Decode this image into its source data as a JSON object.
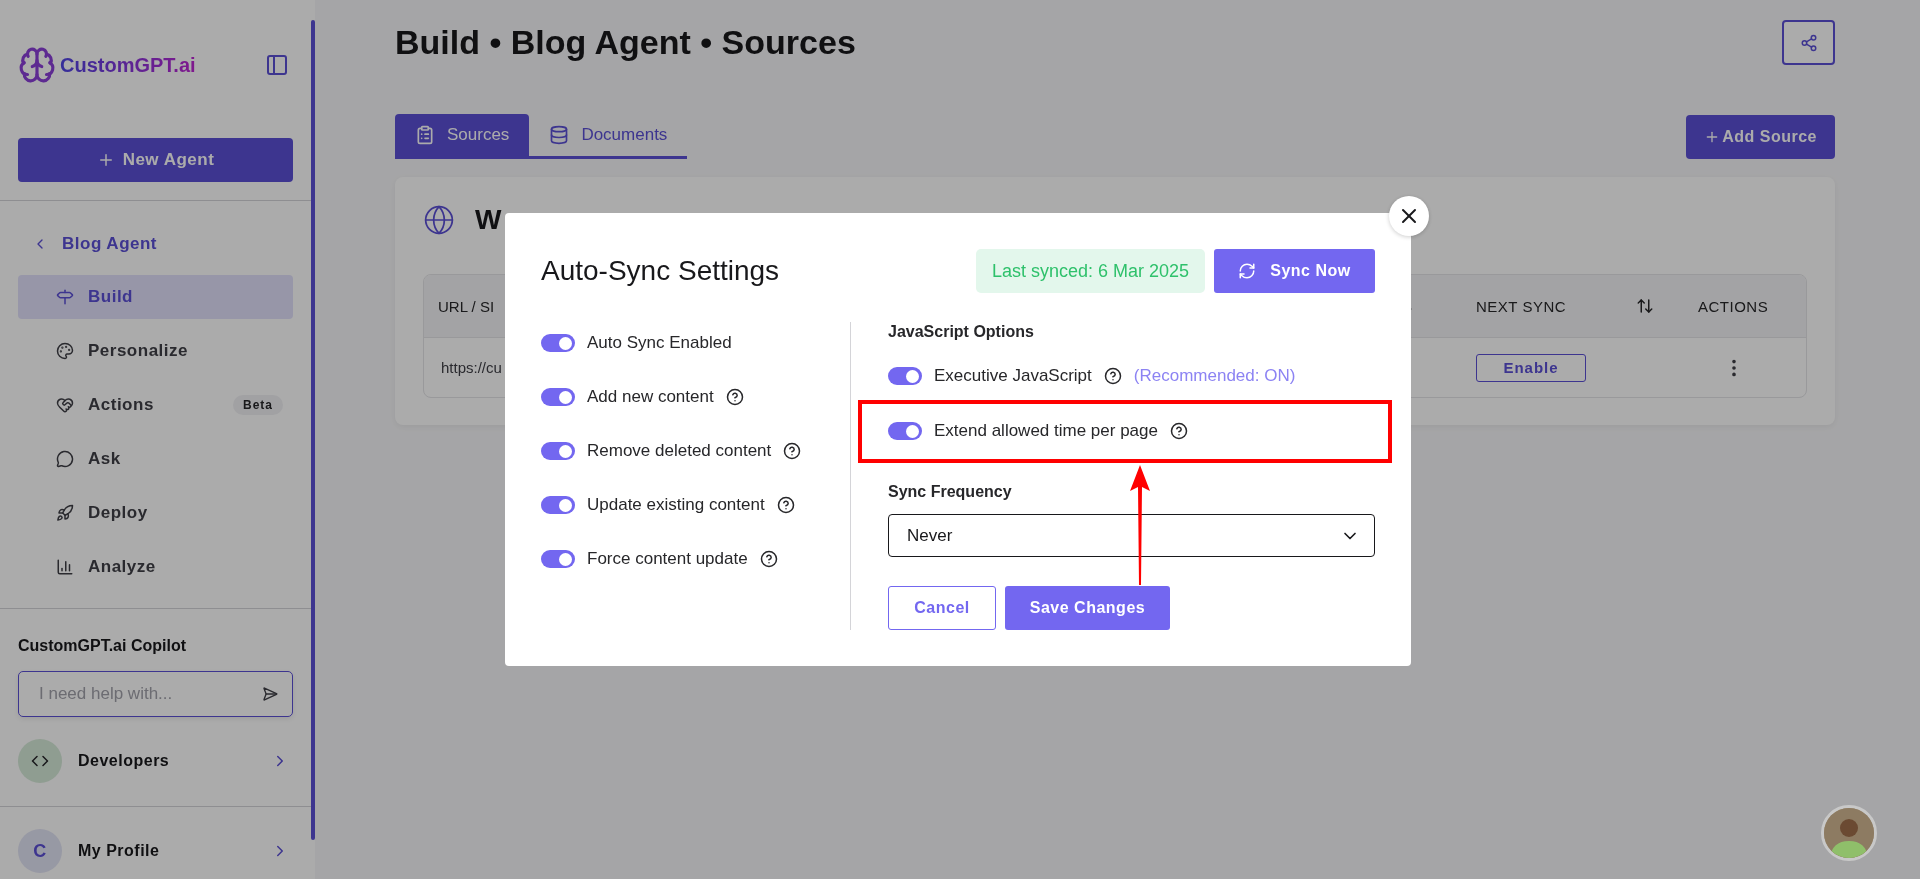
{
  "sidebar": {
    "logo": "CustomGPT.ai",
    "new_agent": "New Agent",
    "back": "Blog Agent",
    "items": [
      {
        "label": "Build",
        "selected": true
      },
      {
        "label": "Personalize",
        "selected": false
      },
      {
        "label": "Actions",
        "selected": false,
        "badge": "Beta"
      },
      {
        "label": "Ask",
        "selected": false
      },
      {
        "label": "Deploy",
        "selected": false
      },
      {
        "label": "Analyze",
        "selected": false
      }
    ],
    "copilot": {
      "title": "CustomGPT.ai Copilot",
      "placeholder": "I need help with..."
    },
    "developers": "Developers",
    "profile": {
      "initial": "C",
      "label": "My Profile"
    }
  },
  "page_title": "Build • Blog Agent • Sources",
  "tabs": [
    {
      "label": "Sources",
      "selected": true
    },
    {
      "label": "Documents",
      "selected": false
    }
  ],
  "add_source": "Add Source",
  "card": {
    "title": "W",
    "table": {
      "columns": [
        "URL / SI",
        "NEXT SYNC",
        "ACTIONS"
      ],
      "rows": [
        {
          "url": "https://cu",
          "next_sync": "Enable"
        }
      ]
    }
  },
  "modal": {
    "title": "Auto-Sync Settings",
    "last_synced": "Last synced: 6 Mar 2025",
    "sync_now": "Sync Now",
    "options": [
      {
        "label": "Auto Sync Enabled",
        "on": true,
        "help": false
      },
      {
        "label": "Add new content",
        "on": true,
        "help": true
      },
      {
        "label": "Remove deleted content",
        "on": true,
        "help": true
      },
      {
        "label": "Update existing content",
        "on": true,
        "help": true
      },
      {
        "label": "Force content update",
        "on": true,
        "help": true
      }
    ],
    "js": {
      "title": "JavaScript Options",
      "options": [
        {
          "label": "Executive JavaScript",
          "on": true,
          "help": true,
          "note": "(Recommended: ON)",
          "highlighted": false
        },
        {
          "label": "Extend allowed time per page",
          "on": true,
          "help": true,
          "highlighted": true
        }
      ]
    },
    "frequency": {
      "label": "Sync Frequency",
      "value": "Never"
    },
    "cancel": "Cancel",
    "save": "Save Changes"
  }
}
